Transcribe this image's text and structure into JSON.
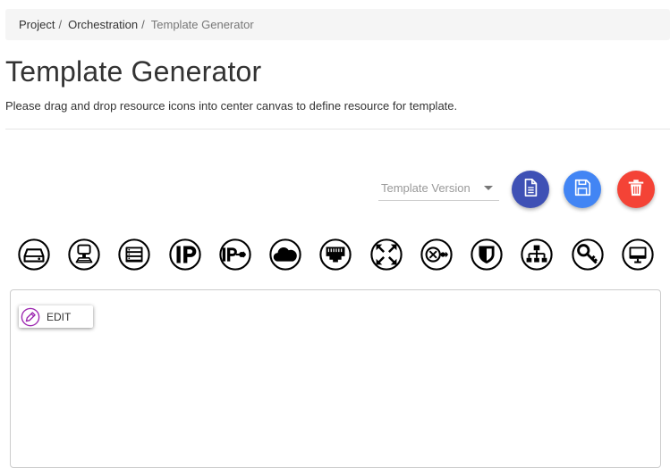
{
  "breadcrumb": {
    "items": [
      "Project",
      "Orchestration"
    ],
    "separator": "/",
    "active": "Template Generator"
  },
  "page": {
    "title": "Template Generator",
    "description": "Please drag and drop resource icons into center canvas to define resource for template."
  },
  "toolbar": {
    "version_placeholder": "Template Version",
    "actions": [
      {
        "name": "template-file-button",
        "icon": "file-text-icon",
        "color": "#3f51b5"
      },
      {
        "name": "save-template-button",
        "icon": "save-icon",
        "color": "#4285f4"
      },
      {
        "name": "delete-template-button",
        "icon": "trash-icon",
        "color": "#f44336"
      }
    ]
  },
  "resource_icons": [
    "volume-icon",
    "server-icon",
    "rack-server-icon",
    "floating-ip-icon",
    "port-ip-icon",
    "cloud-icon",
    "network-port-icon",
    "expand-arrows-icon",
    "router-icon",
    "security-group-icon",
    "network-topology-icon",
    "key-pair-icon",
    "monitor-icon"
  ],
  "canvas": {
    "edit_label": "EDIT",
    "edit_icon": "pencil-icon",
    "edit_icon_color": "#9c27b0"
  }
}
